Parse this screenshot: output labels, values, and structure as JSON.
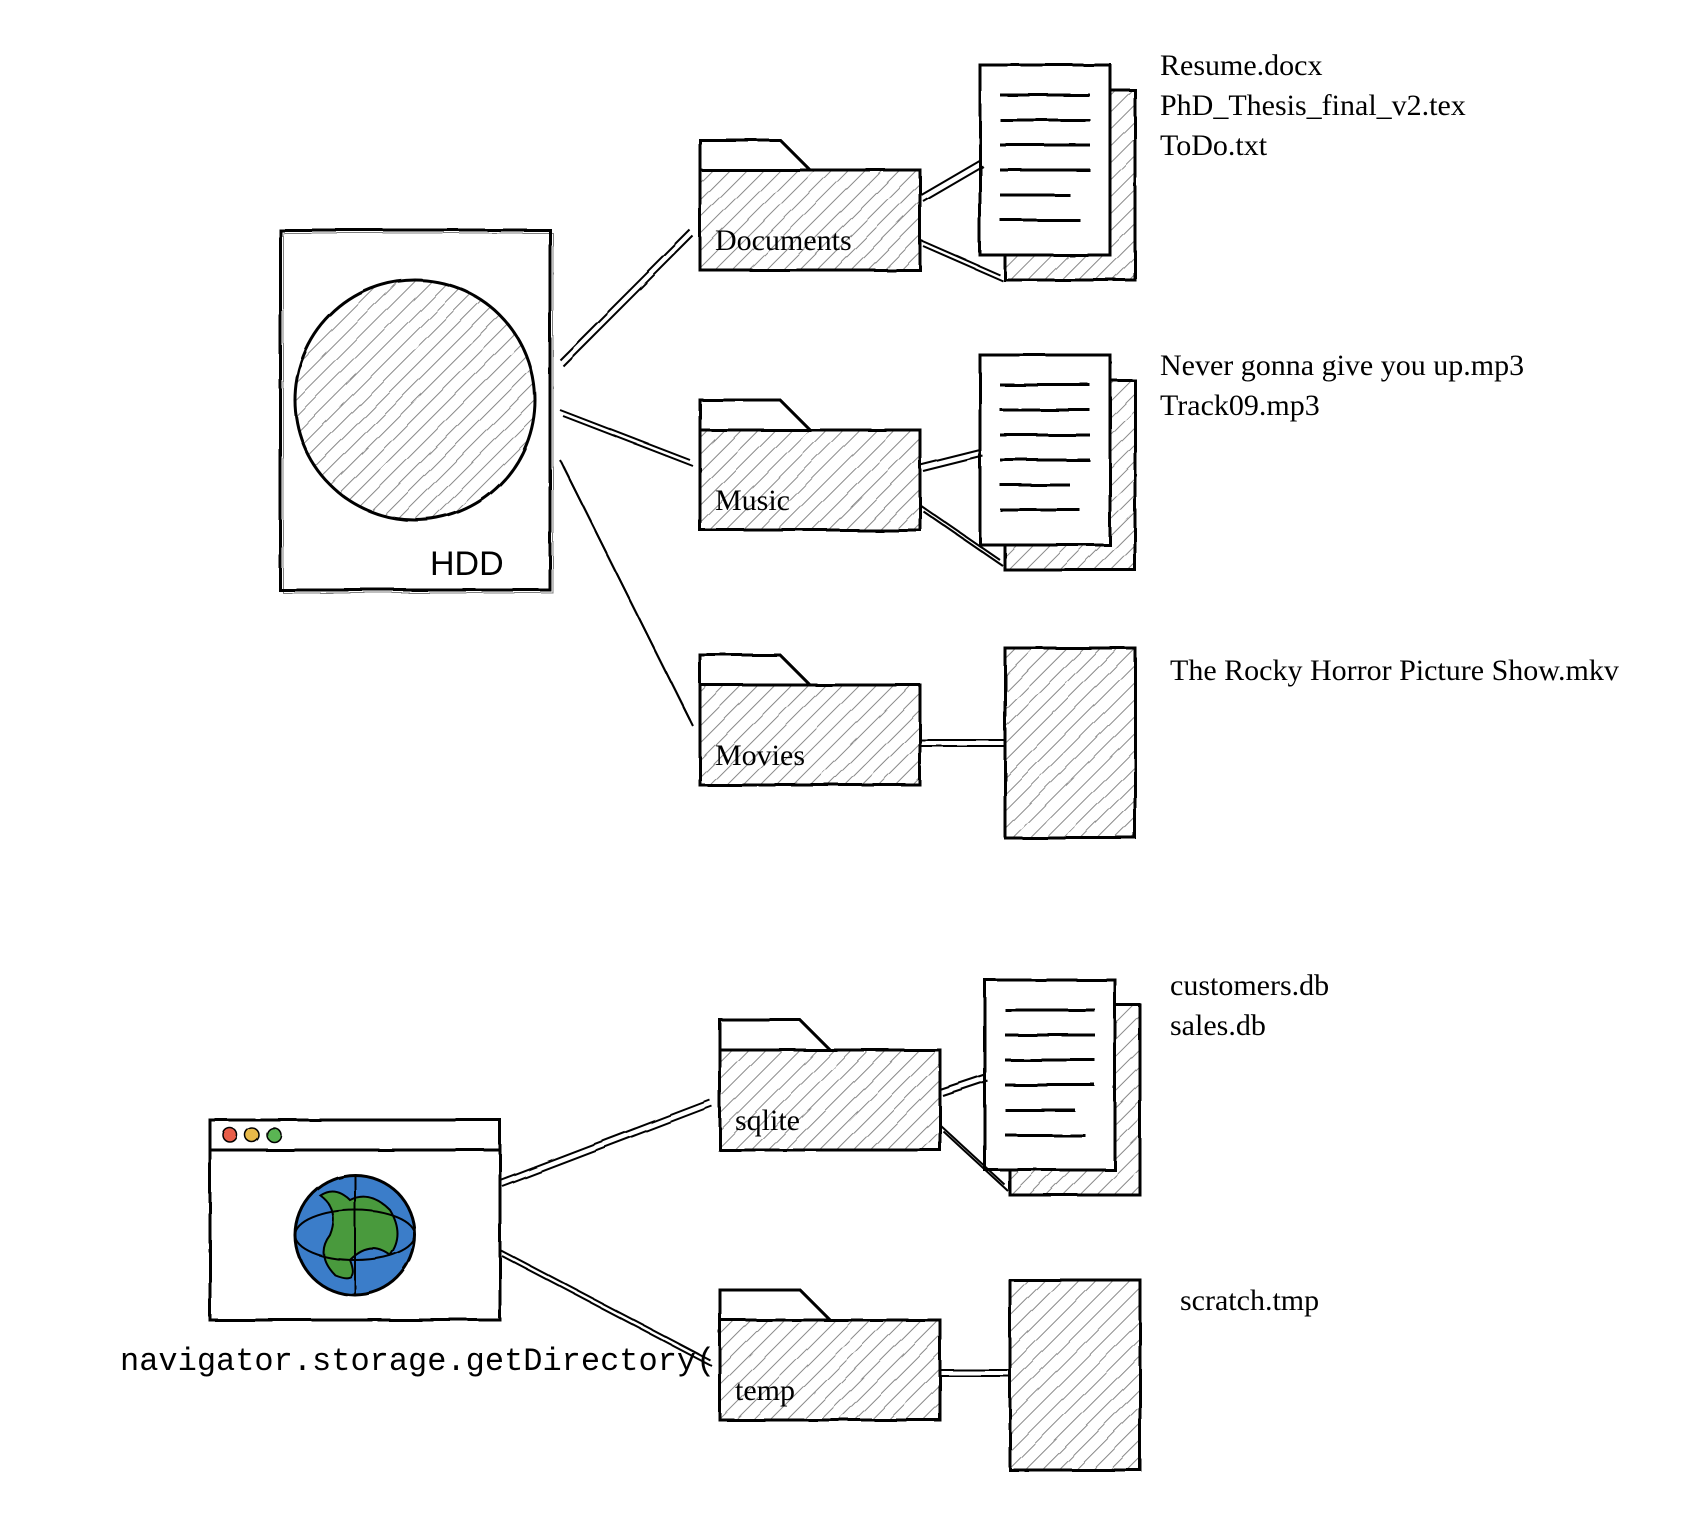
{
  "hdd": {
    "label": "HDD",
    "folders": [
      {
        "name": "Documents",
        "files": [
          "Resume.docx",
          "PhD_Thesis_final_v2.tex",
          "ToDo.txt"
        ]
      },
      {
        "name": "Music",
        "files": [
          "Never gonna give you up.mp3",
          "Track09.mp3"
        ]
      },
      {
        "name": "Movies",
        "files": [
          "The Rocky Horror Picture Show.mkv"
        ]
      }
    ]
  },
  "browser": {
    "api_call": "navigator.storage.getDirectory()",
    "folders": [
      {
        "name": "sqlite",
        "files": [
          "customers.db",
          "sales.db"
        ]
      },
      {
        "name": "temp",
        "files": [
          "scratch.tmp"
        ]
      }
    ]
  }
}
